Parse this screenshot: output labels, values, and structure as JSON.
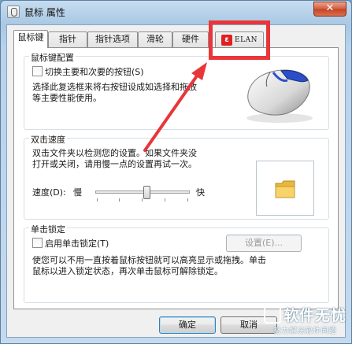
{
  "window": {
    "title": "鼠标 属性",
    "close_glyph": "✕"
  },
  "tabs": [
    {
      "label": "鼠标键",
      "active": true
    },
    {
      "label": "指针"
    },
    {
      "label": "指针选项"
    },
    {
      "label": "滑轮"
    },
    {
      "label": "硬件"
    },
    {
      "label": "ELAN",
      "logo_glyph": "ε"
    }
  ],
  "button_config": {
    "group_label": "鼠标键配置",
    "swap_checkbox_label": "切换主要和次要的按钮(S)",
    "swap_checked": false,
    "description_line1": "选择此复选框来将右按钮设成如选择和拖放",
    "description_line2": "等主要性能使用。"
  },
  "double_click": {
    "group_label": "双击速度",
    "description_line1": "双击文件夹以检测您的设置。如果文件夹没",
    "description_line2": "打开或关闭，请用慢一点的设置再试一次。",
    "speed_label": "速度(D):",
    "slow_label": "慢",
    "fast_label": "快",
    "speed_level": 0.55
  },
  "click_lock": {
    "group_label": "单击锁定",
    "checkbox_label": "启用单击锁定(T)",
    "checked": false,
    "settings_button": "设置(E)...",
    "description_line1": "使您可以不用一直按着鼠标按钮就可以高亮显示或拖拽。单击",
    "description_line2": "鼠标以进入锁定状态，再次单击鼠标可解除锁定。"
  },
  "footer": {
    "ok_button": "确定",
    "cancel_button": "取消"
  },
  "watermark": {
    "main": "软件无忧",
    "sub": "努力解决软件问题"
  },
  "colors": {
    "annotation_red": "#e8363a",
    "folder": "#f2c94c"
  }
}
